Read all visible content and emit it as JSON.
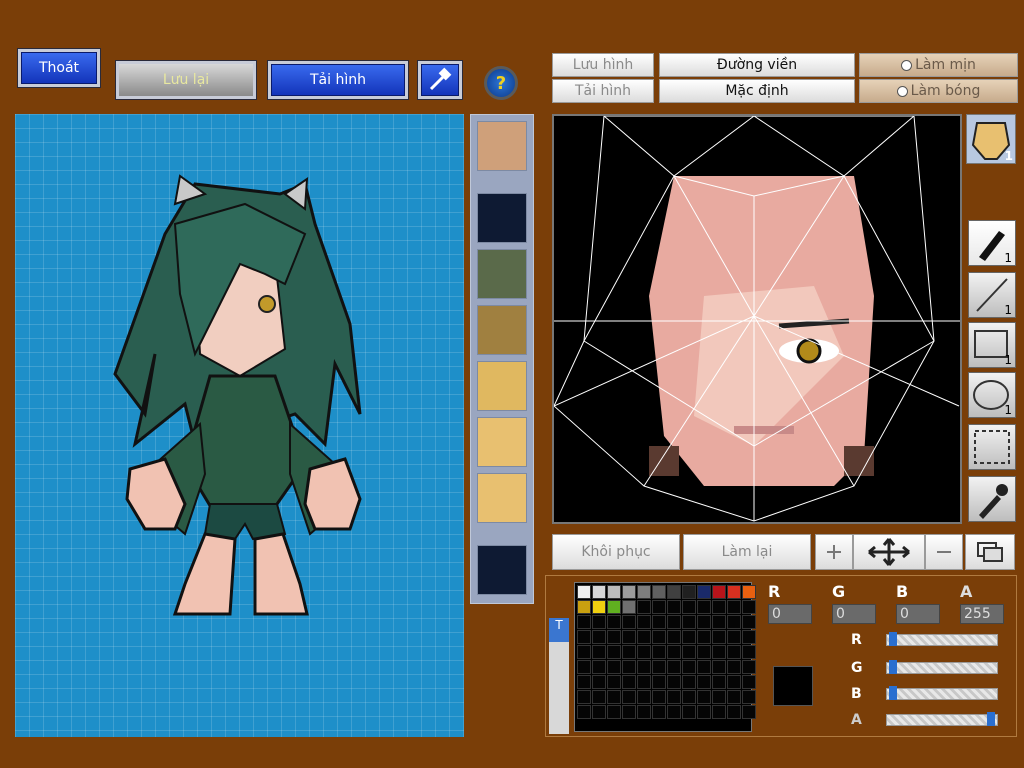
{
  "top_buttons": {
    "exit": "Thoát",
    "save": "Lưu lại",
    "load": "Tải hình",
    "help_icon": "?"
  },
  "editor_tabs": {
    "save_image": "Lưu hình",
    "load_image": "Tải hình",
    "outline": "Đường viền",
    "default": "Mặc định",
    "smooth": "Làm mịn",
    "shine": "Làm bóng"
  },
  "bottom_buttons": {
    "restore": "Khôi phục",
    "redo": "Làm lại"
  },
  "tool_counts": [
    "1",
    "1",
    "1",
    "1"
  ],
  "face_badge": "1",
  "color": {
    "labels": [
      "R",
      "G",
      "B",
      "A"
    ],
    "values": [
      "0",
      "0",
      "0",
      "255"
    ],
    "sliders": [
      0.02,
      0.02,
      0.02,
      0.98
    ],
    "current": "#000000"
  },
  "palette": [
    "#f0f0f0",
    "#d8d8d8",
    "#bcbcbc",
    "#9c9c9c",
    "#7e7e7e",
    "#606060",
    "#404040",
    "#202020",
    "#1a2a6a",
    "#b8141a",
    "#d83020",
    "#e86010",
    "#c8a010",
    "#f0d010",
    "#60b020",
    "#707070"
  ],
  "palette_tab": "T"
}
